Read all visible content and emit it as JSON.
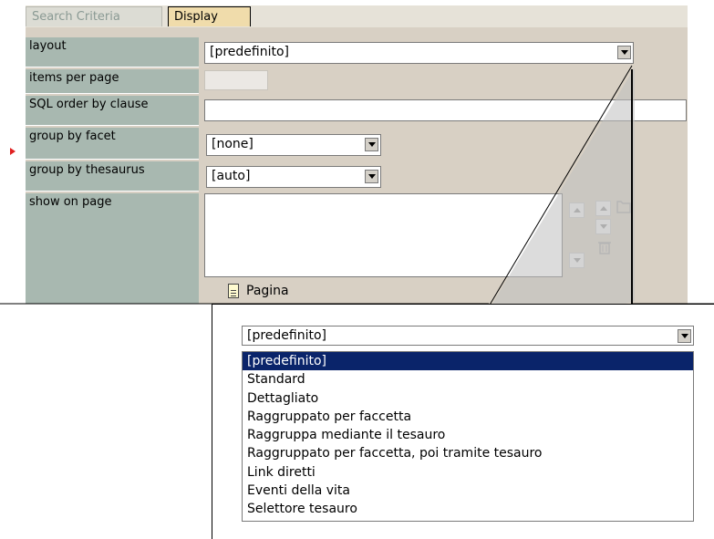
{
  "tabs": [
    {
      "label": "Search Criteria",
      "active": false
    },
    {
      "label": "Display",
      "active": true
    }
  ],
  "form": {
    "layout": {
      "label": "layout",
      "value": "[predefinito]"
    },
    "items_per_page": {
      "label": "items per page",
      "value": ""
    },
    "sql_order_by": {
      "label": "SQL order by clause",
      "value": ""
    },
    "group_by_facet": {
      "label": "group by facet",
      "value": "[none]"
    },
    "group_by_thesaurus": {
      "label": "group by thesaurus",
      "value": "[auto]"
    },
    "show_on_page": {
      "label": "show on page",
      "link": "Pagina"
    }
  },
  "popup": {
    "select_value": "[predefinito]",
    "options": [
      "[predefinito]",
      "Standard",
      "Dettagliato",
      "Raggruppato per faccetta",
      "Raggruppa mediante il tesauro",
      "Raggruppato per faccetta, poi tramite tesauro",
      "Link diretti",
      "Eventi della vita",
      "Selettore tesauro"
    ],
    "selected_index": 0
  },
  "colors": {
    "label_bg": "#a8b8b0",
    "panel_bg": "#d8d0c4",
    "active_tab": "#f0dcab",
    "selection": "#0a246a",
    "marker": "#e02020"
  },
  "icons": [
    "page-icon",
    "trash-icon",
    "folder-icon",
    "chevron-down-icon",
    "arrow-up-icon",
    "arrow-down-icon"
  ]
}
